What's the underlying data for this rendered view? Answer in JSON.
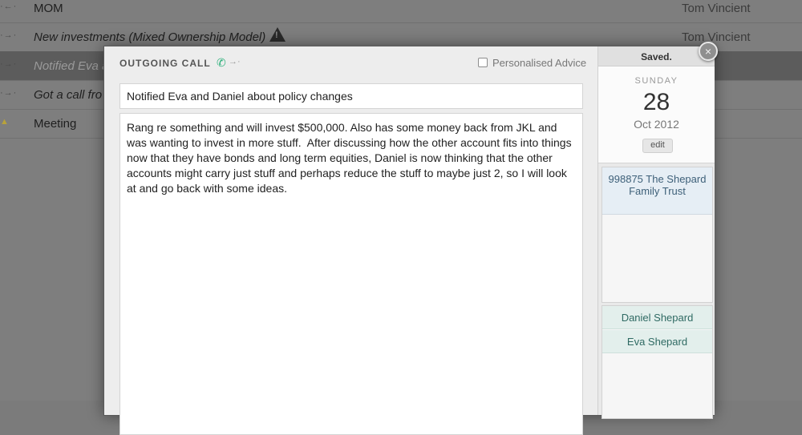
{
  "background_list": {
    "rows": [
      {
        "title": "MOM",
        "owner": "Tom Vincient"
      },
      {
        "title": "New investments (Mixed Ownership Model)",
        "owner": "Tom Vincient"
      },
      {
        "title": "Notified Eva a",
        "owner": "ncient"
      },
      {
        "title": "Got a call fro",
        "owner": "ncient"
      },
      {
        "title": "Meeting",
        "owner": "ncient"
      }
    ]
  },
  "modal": {
    "call_type": "OUTGOING CALL",
    "personalised_advice_label": "Personalised Advice",
    "personalised_advice_checked": false,
    "subject": "Notified Eva and Daniel about policy changes",
    "body": "Rang re something and will invest $500,000. Also has some money back from JKL and was wanting to invest in more stuff.  After discussing how the other account fits into things now that they have bonds and long term equities, Daniel is now thinking that the other accounts might carry just stuff and perhaps reduce the stuff to maybe just 2, so I will look at and go back with some ideas."
  },
  "side": {
    "status": "Saved.",
    "weekday": "SUNDAY",
    "day": "28",
    "month_year": "Oct 2012",
    "edit_label": "edit",
    "account": "998875 The Shepard Family Trust",
    "people": [
      "Daniel Shepard",
      "Eva Shepard"
    ]
  },
  "close_label": "×"
}
